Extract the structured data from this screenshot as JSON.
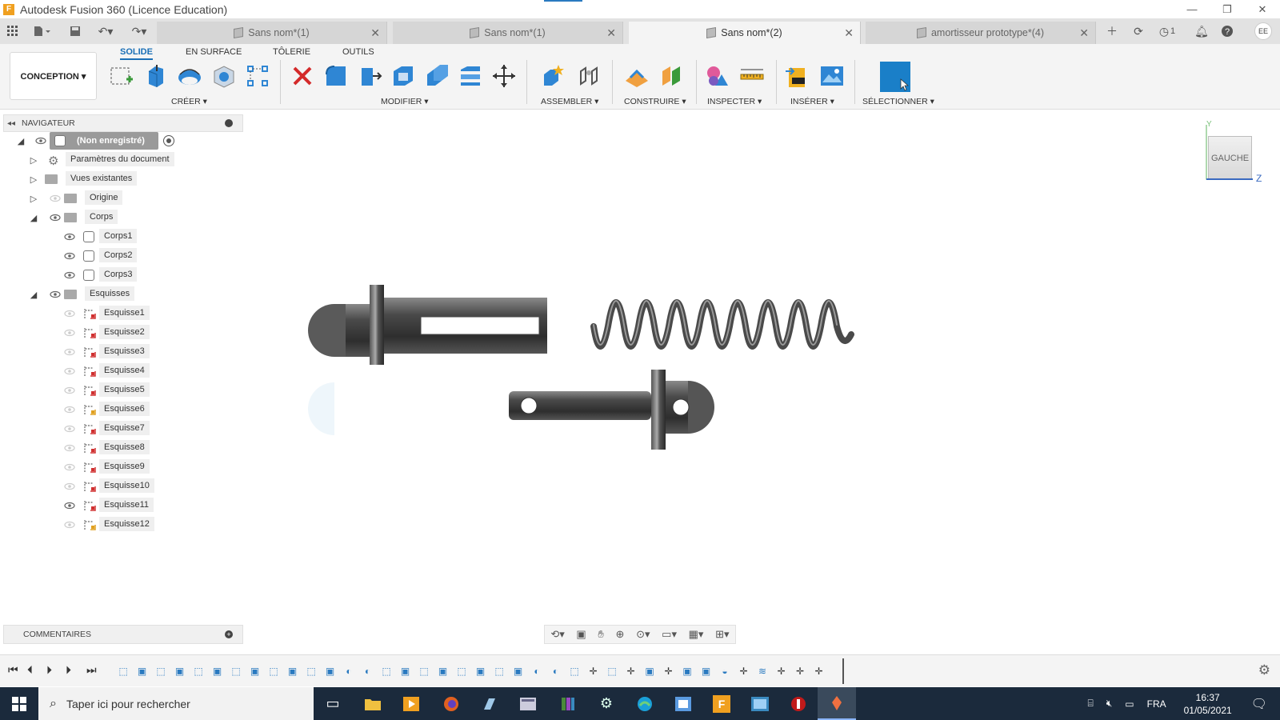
{
  "window": {
    "logo": "F",
    "title": "Autodesk Fusion 360 (Licence Education)",
    "minimize": "—",
    "restore": "❐",
    "close": "✕"
  },
  "tabs": [
    {
      "label": "Sans nom*(1)",
      "active": false
    },
    {
      "label": "Sans nom*(1)",
      "active": false
    },
    {
      "label": "Sans nom*(2)",
      "active": true
    },
    {
      "label": "amortisseur prototype*(4)",
      "active": false
    }
  ],
  "topright": {
    "jobs_count": "1",
    "avatar": "EE"
  },
  "toolbar": {
    "workspace": "CONCEPTION ▾",
    "ribbon_tabs": [
      "SOLIDE",
      "EN SURFACE",
      "TÔLERIE",
      "OUTILS"
    ],
    "groups": [
      "CRÉER ▾",
      "MODIFIER ▾",
      "ASSEMBLER ▾",
      "CONSTRUIRE ▾",
      "INSPECTER ▾",
      "INSÉRER ▾",
      "SÉLECTIONNER ▾"
    ]
  },
  "navigator": {
    "title": "NAVIGATEUR",
    "root": "(Non enregistré)",
    "items": [
      {
        "label": "Paramètres du document"
      },
      {
        "label": "Vues existantes"
      },
      {
        "label": "Origine"
      },
      {
        "label": "Corps"
      },
      {
        "label": "Corps1"
      },
      {
        "label": "Corps2"
      },
      {
        "label": "Corps3"
      },
      {
        "label": "Esquisses"
      },
      {
        "label": "Esquisse1"
      },
      {
        "label": "Esquisse2"
      },
      {
        "label": "Esquisse3"
      },
      {
        "label": "Esquisse4"
      },
      {
        "label": "Esquisse5"
      },
      {
        "label": "Esquisse6"
      },
      {
        "label": "Esquisse7"
      },
      {
        "label": "Esquisse8"
      },
      {
        "label": "Esquisse9"
      },
      {
        "label": "Esquisse10"
      },
      {
        "label": "Esquisse11"
      },
      {
        "label": "Esquisse12"
      }
    ]
  },
  "comments": {
    "title": "COMMENTAIRES"
  },
  "viewcube": {
    "face": "GAUCHE",
    "axis_y": "Y",
    "axis_z": "Z"
  },
  "taskbar": {
    "search_placeholder": "Taper ici pour rechercher",
    "language": "FRA",
    "time": "16:37",
    "date": "01/05/2021"
  },
  "colors": {
    "accent": "#1a6fb6",
    "taskbar": "#1b2a3c",
    "canvas": "#ffffff"
  }
}
